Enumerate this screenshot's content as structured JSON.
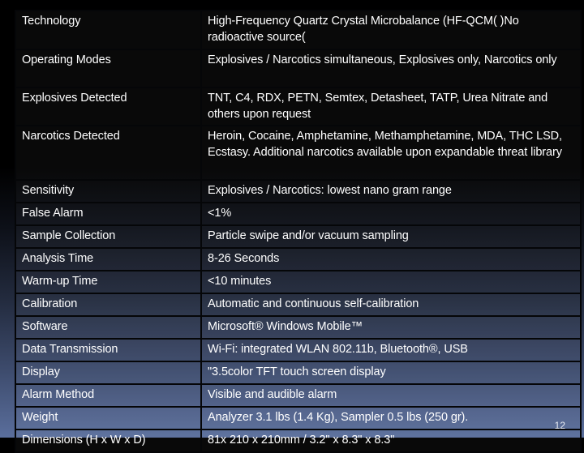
{
  "slide": {
    "page_number": "12",
    "colors": {
      "background_top": "#000000",
      "background_bottom": "#5a6e9c",
      "text": "#ffffff",
      "table_border": "#050608"
    }
  },
  "spec_table": {
    "rows": [
      {
        "label": "Technology",
        "value": "High-Frequency Quartz Crystal Microbalance (HF-QCM( )No radioactive source("
      },
      {
        "label": "Operating Modes",
        "value": "Explosives / Narcotics simultaneous, Explosives only, Narcotics only"
      },
      {
        "label": "Explosives Detected",
        "value": "TNT, C4, RDX, PETN, Semtex, Detasheet, TATP, Urea Nitrate and others upon request"
      },
      {
        "label": "Narcotics Detected",
        "value": "Heroin, Cocaine, Amphetamine, Methamphetamine, MDA, THC LSD, Ecstasy. Additional narcotics available upon expandable threat library"
      },
      {
        "label": "Sensitivity",
        "value": "Explosives / Narcotics: lowest nano gram range"
      },
      {
        "label": "False Alarm",
        "value": "<1%"
      },
      {
        "label": "Sample Collection",
        "value": "Particle swipe and/or vacuum sampling"
      },
      {
        "label": "Analysis Time",
        "value": "8-26 Seconds"
      },
      {
        "label": "Warm-up Time",
        "value": "<10  minutes"
      },
      {
        "label": "Calibration",
        "value": "Automatic and continuous self-calibration"
      },
      {
        "label": "Software",
        "value": "Microsoft® Windows Mobile™"
      },
      {
        "label": "Data Transmission",
        "value": "Wi-Fi: integrated WLAN 802.11b, Bluetooth®, USB"
      },
      {
        "label": "Display",
        "value": " \"3.5color TFT touch screen display"
      },
      {
        "label": "Alarm Method",
        "value": "Visible and audible alarm"
      },
      {
        "label": "Weight",
        "value": "Analyzer 3.1 lbs (1.4 Kg), Sampler 0.5 lbs (250 gr)."
      },
      {
        "label": "Dimensions (H x W x D)",
        "value": " 81x 210 x 210mm / 3.2\" x 8.3\" x 8.3\""
      }
    ]
  }
}
